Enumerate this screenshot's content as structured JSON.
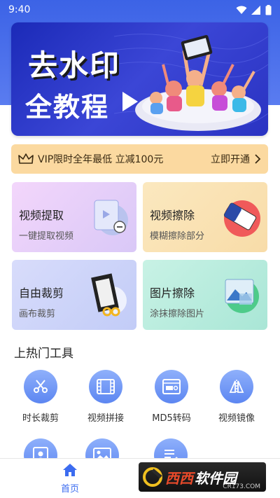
{
  "status_bar": {
    "time": "9:40"
  },
  "banner": {
    "line1": "去水印",
    "line2": "全教程"
  },
  "vip": {
    "text": "VIP限时全年最低 立减100元",
    "action": "立即开通"
  },
  "cards": [
    {
      "title": "视频提取",
      "subtitle": "一键提取视频"
    },
    {
      "title": "视频擦除",
      "subtitle": "模糊擦除部分"
    },
    {
      "title": "自由裁剪",
      "subtitle": "画布裁剪"
    },
    {
      "title": "图片擦除",
      "subtitle": "涂抹擦除图片"
    }
  ],
  "section": {
    "title": "上热门工具"
  },
  "tools": [
    {
      "label": "时长裁剪",
      "icon": "scissors-icon"
    },
    {
      "label": "视频拼接",
      "icon": "film-strip-icon"
    },
    {
      "label": "MD5转码",
      "icon": "md5-icon"
    },
    {
      "label": "视频镜像",
      "icon": "mirror-icon"
    }
  ],
  "tools_row2": [
    {
      "icon": "portrait-icon"
    },
    {
      "icon": "image-icon"
    },
    {
      "icon": "list-edit-icon"
    }
  ],
  "bottom_nav": {
    "home_label": "首页"
  },
  "watermark": {
    "brand1": "西西",
    "brand2": "软件园",
    "url": "CR173.COM"
  },
  "colors": {
    "primary": "#3c6cf0",
    "vip_bg": "#fbd9a0"
  }
}
